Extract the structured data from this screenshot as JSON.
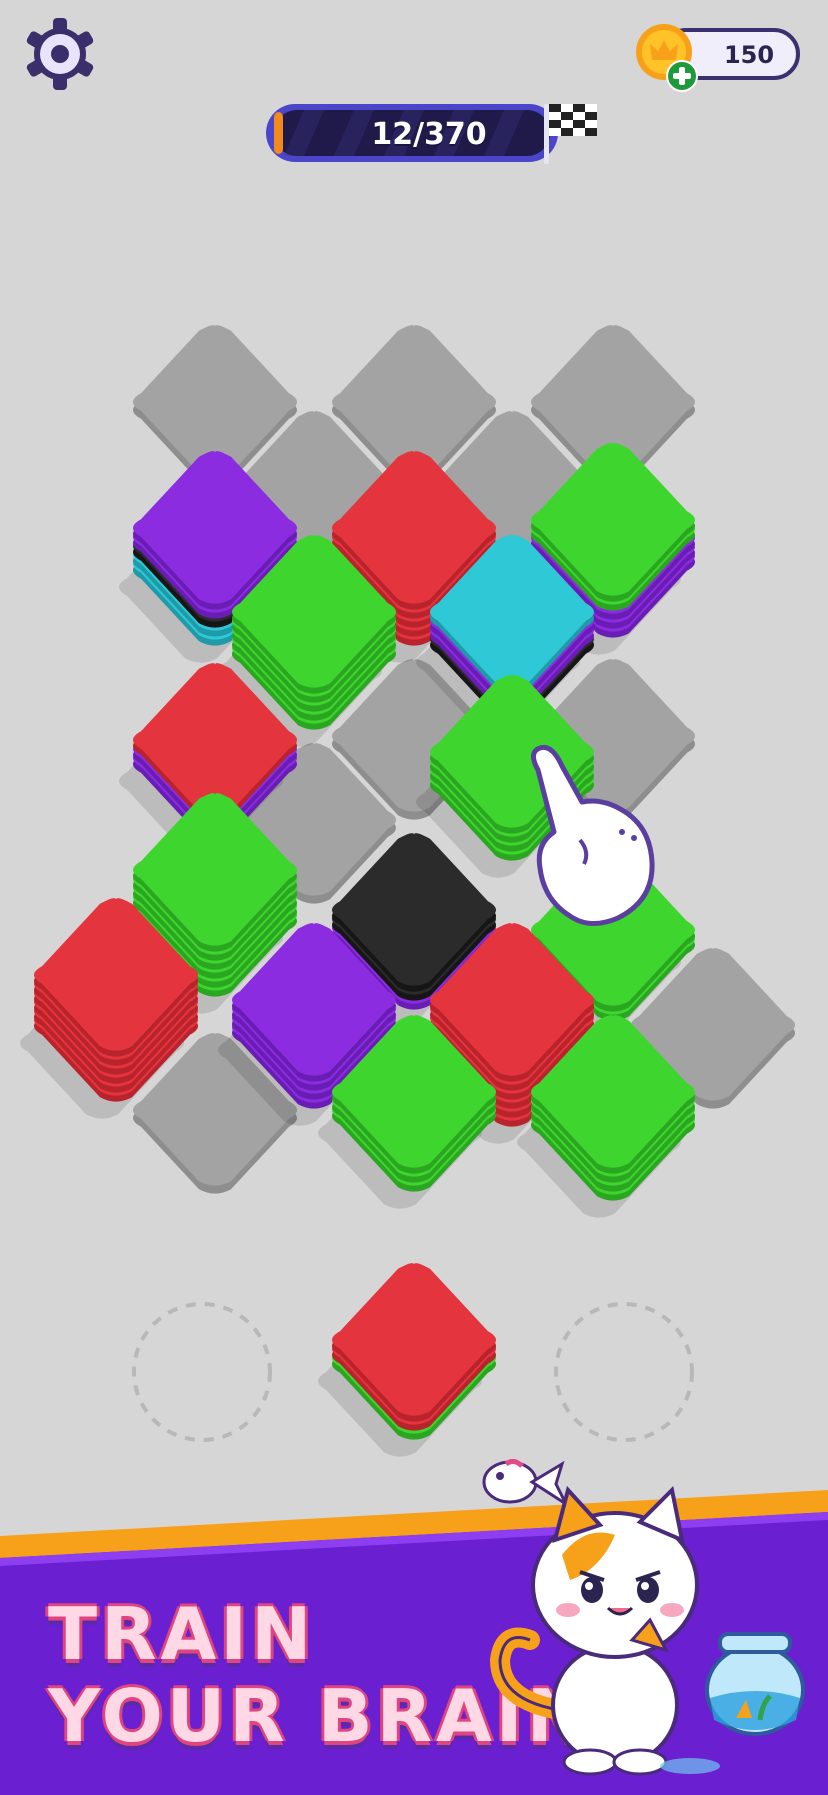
{
  "hud": {
    "settings_icon": "gear-icon",
    "coins": "150",
    "coin_icon": "crown-coin-icon",
    "coin_add_icon": "plus-icon",
    "level_progress_text": "12/370",
    "level_progress_fraction": 0.0324,
    "finish_icon": "checkered-flag-icon"
  },
  "colors": {
    "background": "#d6d6d6",
    "empty_tile": "#a3a3a3",
    "red": "#e4343e",
    "green": "#3ed62e",
    "purple": "#8b2ce0",
    "cyan": "#2ec8d6",
    "black": "#2b2b2b",
    "banner_purple": "#6a1fd1",
    "banner_stripe": "#f7a11a",
    "progress_fill": "#f28a1c"
  },
  "board": {
    "empty_cells": [
      "r0c0",
      "r0c1",
      "r0c2",
      "r1c0",
      "r1c1",
      "r3c1",
      "r3c2",
      "r4c0",
      "r5c2",
      "r6c0",
      "r6c1"
    ],
    "stacks": [
      {
        "cell": "r2c0",
        "top": "purple",
        "layers": [
          "purple",
          "purple",
          "black",
          "cyan",
          "cyan"
        ]
      },
      {
        "cell": "r2c1",
        "top": "red",
        "layers": [
          "red",
          "red",
          "red",
          "red",
          "red"
        ]
      },
      {
        "cell": "r2c2",
        "top": "green",
        "layers": [
          "green",
          "green",
          "purple",
          "purple",
          "purple"
        ]
      },
      {
        "cell": "r3c0",
        "top": "green",
        "layers": [
          "green",
          "green",
          "green",
          "green",
          "green"
        ]
      },
      {
        "cell": "r3c1b",
        "top": "cyan",
        "layers": [
          "cyan",
          "purple",
          "purple",
          "black"
        ]
      },
      {
        "cell": "r4c1",
        "top": "red",
        "layers": [
          "red",
          "purple",
          "purple"
        ]
      },
      {
        "cell": "r5c0",
        "top": "green",
        "layers": [
          "green",
          "green",
          "green",
          "green",
          "green",
          "green"
        ]
      },
      {
        "cell": "r5c1",
        "top": "black",
        "layers": [
          "black",
          "black",
          "purple"
        ]
      },
      {
        "cell": "r6b",
        "top": "red",
        "layers": [
          "red",
          "red",
          "red",
          "red",
          "red",
          "red"
        ]
      },
      {
        "cell": "r6c",
        "top": "purple",
        "layers": [
          "purple",
          "purple",
          "purple",
          "purple"
        ]
      },
      {
        "cell": "r6d",
        "top": "red",
        "layers": [
          "red",
          "red",
          "red",
          "red",
          "red",
          "red"
        ]
      },
      {
        "cell": "r6e",
        "top": "green",
        "layers": [
          "green",
          "green"
        ]
      },
      {
        "cell": "r7a",
        "top": "green",
        "layers": [
          "green",
          "green",
          "green"
        ]
      },
      {
        "cell": "r7b",
        "top": "green",
        "layers": [
          "green",
          "green",
          "green",
          "green"
        ]
      }
    ],
    "lifted_stack": {
      "top": "green",
      "layers": [
        "green",
        "green",
        "green",
        "green"
      ]
    }
  },
  "tray": {
    "slots": [
      {
        "state": "empty"
      },
      {
        "state": "filled",
        "top": "red",
        "layers": [
          "red",
          "red",
          "green"
        ]
      },
      {
        "state": "empty"
      }
    ]
  },
  "tutorial": {
    "hand_icon": "pointing-hand-icon"
  },
  "banner": {
    "line1": "TRAIN",
    "line2": "YOUR BRAIN",
    "mascot_icon": "cat-mascot-icon",
    "fish_icon": "fish-icon",
    "fishbowl_icon": "fishbowl-icon"
  }
}
